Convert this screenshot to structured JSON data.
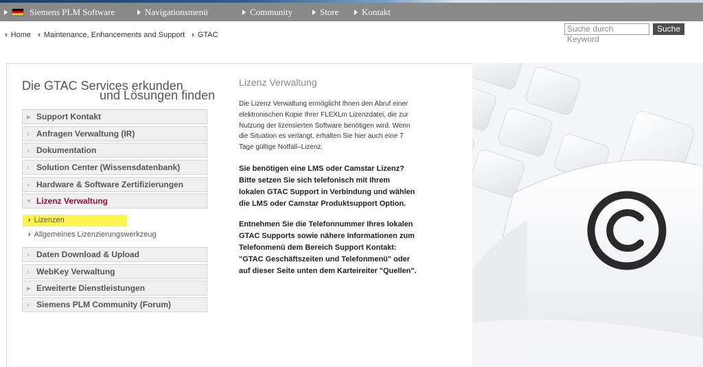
{
  "topnav": {
    "items": [
      {
        "label": "Siemens PLM Software"
      },
      {
        "label": "Navigationsmenü"
      },
      {
        "label": "Community"
      },
      {
        "label": "Store"
      },
      {
        "label": "Kontakt"
      }
    ],
    "flag_colors": [
      "#000000",
      "#dd0000",
      "#ffce00"
    ]
  },
  "breadcrumb": [
    {
      "label": "Home"
    },
    {
      "label": "Maintenance, Enhancements and Support"
    },
    {
      "label": "GTAC"
    }
  ],
  "search": {
    "placeholder": "Suche durch Keyword",
    "button_label": "Suche"
  },
  "sidebar": {
    "heading_line1": "Die GTAC Services erkunden",
    "heading_line2": "und Lösungen finden",
    "items": [
      {
        "label": "Support Kontakt",
        "icon": "triangle-right"
      },
      {
        "label": "Anfragen Verwaltung (IR)",
        "icon": "chevron-right"
      },
      {
        "label": "Dokumentation",
        "icon": "chevron-right"
      },
      {
        "label": "Solution Center (Wissensdatenbank)",
        "icon": "chevron-right"
      },
      {
        "label": "Hardware & Software Zertifizierungen",
        "icon": "chevron-right"
      },
      {
        "label": "Lizenz Verwaltung",
        "icon": "triangle-down",
        "active": true
      },
      {
        "label": "Daten Download & Upload",
        "icon": "chevron-right"
      },
      {
        "label": "WebKey Verwaltung",
        "icon": "chevron-right"
      },
      {
        "label": "Erweiterte Dienstleistungen",
        "icon": "triangle-right"
      },
      {
        "label": "Siemens PLM Community (Forum)",
        "icon": "chevron-right"
      }
    ],
    "subitems": [
      {
        "label": "Lizenzen",
        "highlighted": true
      },
      {
        "label": "Allgemeines Lizenzierungswerkzeug"
      }
    ]
  },
  "main": {
    "title": "Lizenz Verwaltung",
    "p1_lines": [
      "Die Lizenz Verwaltung ermöglicht Ihnen den Abruf einer",
      "elektronischen Kopie Ihrer FLEXLm Lizenzdatei, die zur",
      "Nutzung der lizensierten Software benötigen wird. Wenn",
      "die Situation es verlangt, erhalten Sie hier auch eine 7",
      "Tage gültige Notfall–Lizenz."
    ],
    "p2_lines": [
      "Sie benötigen eine LMS oder Camstar Lizenz?",
      "Bitte setzen Sie sich telefonisch mit Ihrem",
      "lokalen GTAC Support in Verbindung und wählen",
      "die LMS oder Camstar Produktsupport Option."
    ],
    "p3_lines": [
      "Entnehmen Sie die Telefonnummer Ihres lokalen",
      "GTAC Supports sowie nähere Informationen zum",
      "Telefonmenü dem Bereich Support Kontakt:",
      "\"GTAC Geschäftszeiten und Telefonmenü\" oder",
      "auf dieser Seite unten dem Karteireiter \"Quellen\"."
    ]
  },
  "hero": {
    "description_icon": "keyboard-copyright-key-image",
    "symbol": "©"
  },
  "colors": {
    "nav_bg": "#898989",
    "accent": "#a00d2e",
    "highlight": "#fff34f"
  }
}
